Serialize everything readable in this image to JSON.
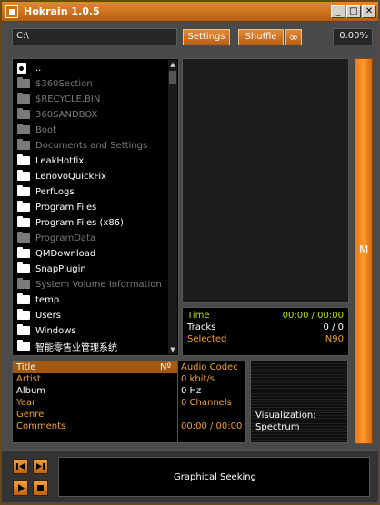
{
  "window": {
    "title": "Hokrain 1.0.5",
    "minimize": "_",
    "maximize": "□",
    "close": "✕"
  },
  "toolbar": {
    "path": "C:\\",
    "settings_label": "Settings",
    "shuffle_label": "Shuffle",
    "loop_label": "∞",
    "progress_percent": "0.00%"
  },
  "files": [
    {
      "name": "..",
      "kind": "drive",
      "color": "#ffffff"
    },
    {
      "name": "$360Section",
      "kind": "folder",
      "color": "#7a7a7a"
    },
    {
      "name": "$RECYCLE.BIN",
      "kind": "folder",
      "color": "#7a7a7a"
    },
    {
      "name": "360SANDBOX",
      "kind": "folder",
      "color": "#7a7a7a"
    },
    {
      "name": "Boot",
      "kind": "folder",
      "color": "#7a7a7a"
    },
    {
      "name": "Documents and Settings",
      "kind": "folder",
      "color": "#7a7a7a"
    },
    {
      "name": "LeakHotfix",
      "kind": "folder",
      "color": "#ffffff"
    },
    {
      "name": "LenovoQuickFix",
      "kind": "folder",
      "color": "#ffffff"
    },
    {
      "name": "PerfLogs",
      "kind": "folder",
      "color": "#ffffff"
    },
    {
      "name": "Program Files",
      "kind": "folder",
      "color": "#ffffff"
    },
    {
      "name": "Program Files (x86)",
      "kind": "folder",
      "color": "#ffffff"
    },
    {
      "name": "ProgramData",
      "kind": "folder",
      "color": "#7a7a7a"
    },
    {
      "name": "QMDownload",
      "kind": "folder",
      "color": "#ffffff"
    },
    {
      "name": "SnapPlugin",
      "kind": "folder",
      "color": "#ffffff"
    },
    {
      "name": "System Volume Information",
      "kind": "folder",
      "color": "#7a7a7a"
    },
    {
      "name": "temp",
      "kind": "folder",
      "color": "#ffffff"
    },
    {
      "name": "Users",
      "kind": "folder",
      "color": "#ffffff"
    },
    {
      "name": "Windows",
      "kind": "folder",
      "color": "#ffffff"
    },
    {
      "name": "智能零售业管理系统",
      "kind": "folder",
      "color": "#ffffff"
    }
  ],
  "playback": {
    "time_label": "Time",
    "time_value": "00:00 / 00:00",
    "tracks_label": "Tracks",
    "tracks_value": "0 / 0",
    "selected_label": "Selected",
    "selected_value": "N90"
  },
  "side_button": "M",
  "meta": {
    "left_labels": [
      "Title",
      "Artist",
      "Album",
      "Year",
      "Genre",
      "Comments"
    ],
    "number_label": "Nº",
    "right_values": [
      "Audio Codec",
      "0 kbit/s",
      "0 Hz",
      "0 Channels",
      "",
      "00:00 / 00:00"
    ]
  },
  "visualization": {
    "label": "Visualization:",
    "mode": "Spectrum"
  },
  "seek": {
    "label": "Graphical Seeking"
  },
  "colors": {
    "accent": "#e07a1c",
    "green": "#b8e000",
    "orange_text": "#f0a030"
  }
}
